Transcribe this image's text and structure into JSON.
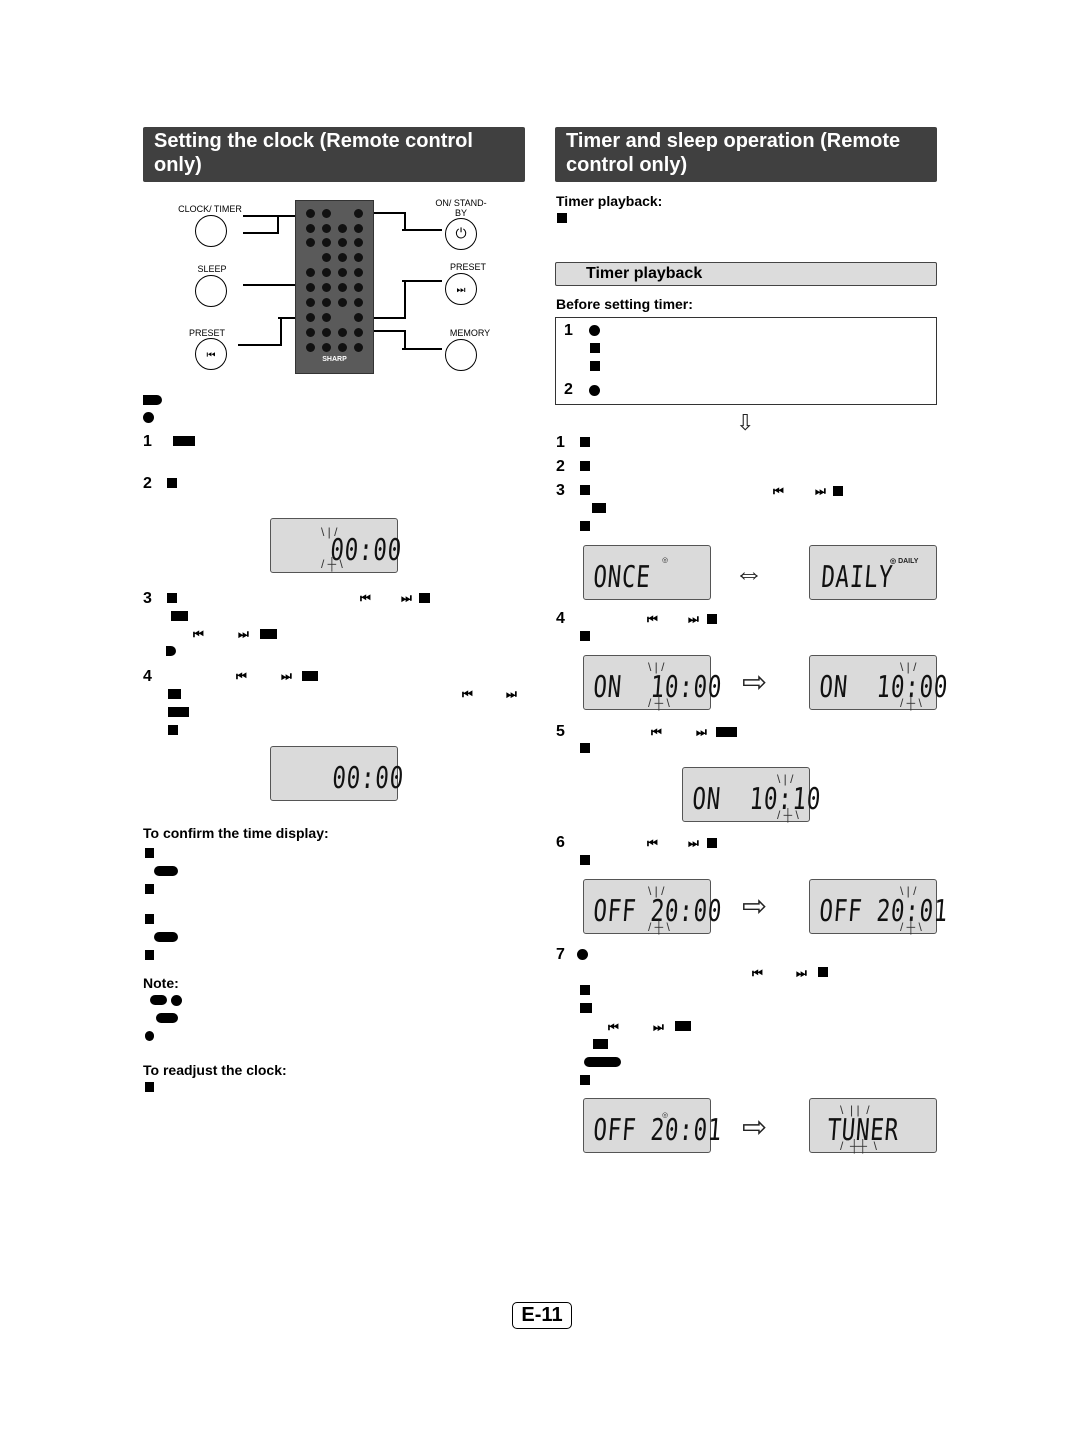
{
  "left": {
    "header": "Setting the clock (Remote control only)",
    "remote": {
      "brand": "SHARP",
      "callouts": [
        "CLOCK/ TIMER",
        "SLEEP",
        "PRESET",
        "ON/ STAND-BY",
        "PRESET",
        "MEMORY"
      ],
      "icons": [
        "blank-button",
        "blank-button",
        "previous-icon",
        "power-icon",
        "next-icon",
        "blank-button"
      ]
    },
    "steps": [
      "1",
      "2",
      "3",
      "4"
    ],
    "lcd_1": "00:00",
    "lcd_2": "00:00",
    "confirm_title": "To confirm the time display:",
    "note_title": "Note:",
    "readjust_title": "To readjust the clock:"
  },
  "right": {
    "header": "Timer and sleep operation (Remote control only)",
    "timer_playback_label": "Timer playback:",
    "section_title": "Timer playback",
    "before_title": "Before setting timer:",
    "before_steps": [
      "1",
      "2"
    ],
    "steps": [
      "1",
      "2",
      "3",
      "4",
      "5",
      "6",
      "7"
    ],
    "lcds": {
      "once": "ONCE",
      "daily": "DAILY",
      "daily_badge": "DAILY",
      "on_a": "ON  10:00",
      "on_b": "ON  10:00",
      "on_c": "ON  10:10",
      "off_a": "OFF 20:00",
      "off_b": "OFF 20:01",
      "off_c": "OFF 20:01",
      "tuner": "TUNER"
    }
  },
  "footer": {
    "page_number": "E-11"
  }
}
